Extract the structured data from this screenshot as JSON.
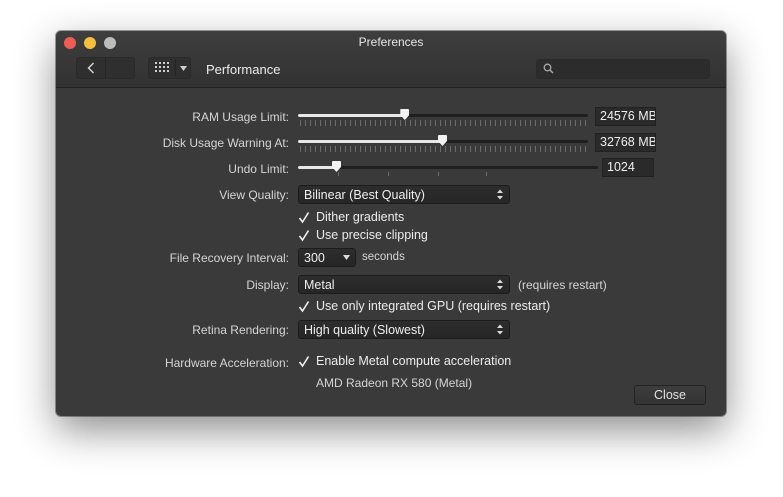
{
  "window": {
    "title": "Preferences"
  },
  "toolbar": {
    "section_title": "Performance",
    "search": {
      "value": "",
      "placeholder": ""
    }
  },
  "settings": {
    "ram_usage_limit": {
      "label": "RAM Usage Limit:",
      "value": "24576 MB",
      "slider_fraction": 0.37
    },
    "disk_usage_warning": {
      "label": "Disk Usage Warning At:",
      "value": "32768 MB",
      "slider_fraction": 0.5
    },
    "undo_limit": {
      "label": "Undo Limit:",
      "value": "1024",
      "slider_fraction": 0.13
    },
    "view_quality": {
      "label": "View Quality:",
      "value": "Bilinear (Best Quality)"
    },
    "dither_gradients": {
      "label": "Dither gradients",
      "checked": true
    },
    "precise_clipping": {
      "label": "Use precise clipping",
      "checked": true
    },
    "file_recovery_interval": {
      "label": "File Recovery Interval:",
      "value": "300",
      "unit": "seconds"
    },
    "display": {
      "label": "Display:",
      "value": "Metal",
      "note": "(requires restart)"
    },
    "integrated_gpu": {
      "label": "Use only integrated GPU (requires restart)",
      "checked": true
    },
    "retina_rendering": {
      "label": "Retina Rendering:",
      "value": "High quality (Slowest)"
    },
    "hardware_acceleration": {
      "label": "Hardware Acceleration:",
      "checkbox_label": "Enable Metal compute acceleration",
      "checked": true,
      "device": "AMD Radeon RX 580 (Metal)"
    }
  },
  "buttons": {
    "close": "Close"
  }
}
